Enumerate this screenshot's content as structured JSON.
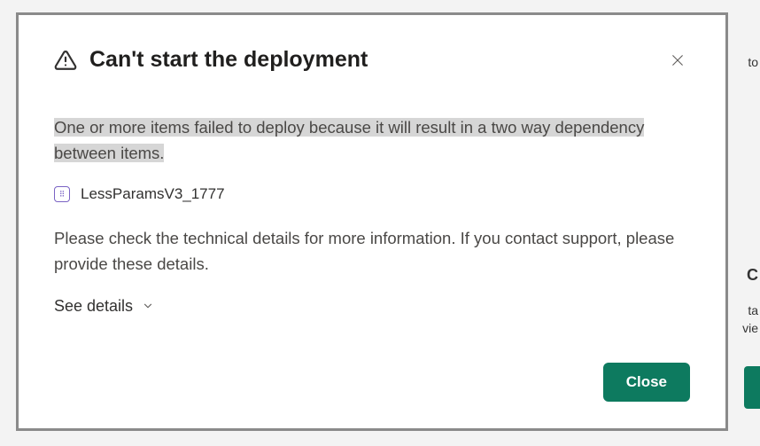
{
  "dialog": {
    "title": "Can't start the deployment",
    "message_highlighted": "One or more items failed to deploy because it will result in a two way dependency between items.",
    "item_name": "LessParamsV3_1777",
    "detail_message": "Please check the technical details for more information. If you contact support, please provide these details.",
    "see_details_label": "See details",
    "close_button": "Close"
  },
  "background": {
    "text_frag_1": "to",
    "text_frag_2": "C",
    "text_frag_3": "ta",
    "text_frag_4": "vie"
  }
}
